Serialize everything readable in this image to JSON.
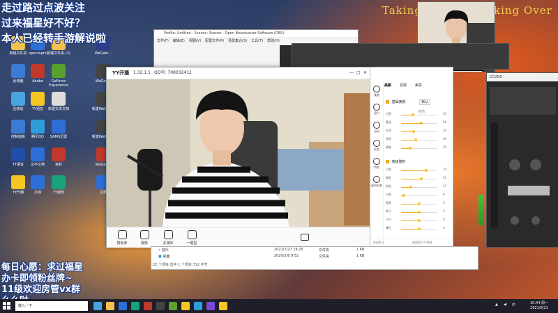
{
  "overlay_top": [
    "走过路过点波关注",
    "过来福星好不好？",
    "本人已经转手游解说啦"
  ],
  "overlay_bottom": [
    "每日心愿：求过福星",
    "办卡即领粉丝牌~",
    "11级欢迎房管vx群",
    "么么哒"
  ],
  "banner": {
    "left": "Taking",
    "right": "king Over"
  },
  "desktop_icons": [
    {
      "label": "新建文件夹",
      "color": "#f2c14e"
    },
    {
      "label": "openmpm",
      "color": "#2d6fd6"
    },
    {
      "label": "新建文件夹 (2)",
      "color": "#f2c14e"
    },
    {
      "label": "WeGam...",
      "color": "#2c3e8a"
    },
    {
      "label": "此电脑",
      "color": "#3a7bd5"
    },
    {
      "label": "Adobe",
      "color": "#c0392b"
    },
    {
      "label": "GeForce Experience",
      "color": "#5aa02c"
    },
    {
      "label": "WeGame",
      "color": "#444"
    },
    {
      "label": "回收站",
      "color": "#4aa3df"
    },
    {
      "label": "YY语音",
      "color": "#f5c623"
    },
    {
      "label": "新建文本文档",
      "color": "#ddd"
    },
    {
      "label": "新建WeGame",
      "color": "#444"
    },
    {
      "label": "控制面板",
      "color": "#3a7bd5"
    },
    {
      "label": "腾讯QQ",
      "color": "#2d9cdb"
    },
    {
      "label": "SAMS迅雷",
      "color": "#2d6fd6"
    },
    {
      "label": "新建WeGame",
      "color": "#444"
    },
    {
      "label": "TT语音",
      "color": "#1f4fa8"
    },
    {
      "label": "文字文档",
      "color": "#2d6fd6"
    },
    {
      "label": "资料",
      "color": "#c0392b"
    },
    {
      "label": "WeGame",
      "color": "#c0392b"
    },
    {
      "label": "YY开播",
      "color": "#f5c623"
    },
    {
      "label": "文档",
      "color": "#2d6fd6"
    },
    {
      "label": "YY游戏",
      "color": "#1aa37a"
    },
    {
      "label": "文档",
      "color": "#2d6fd6"
    }
  ],
  "obs": {
    "title": "Profile: Untitled - Scenes: Scenes - Open Broadcaster Software (OBS)",
    "menu": [
      "文件(F)",
      "编辑(E)",
      "视图(V)",
      "配置文件(P)",
      "场景集合(S)",
      "工具(T)",
      "帮助(H)"
    ]
  },
  "yy": {
    "logo": "YY开播",
    "version": "1.32.1.1",
    "qq": "QQ号: 708032412",
    "bottom_buttons": [
      {
        "label": "模板库"
      },
      {
        "label": "摄像"
      },
      {
        "label": "多媒体"
      },
      {
        "label": "一键抠"
      }
    ],
    "window_controls": [
      "—",
      "□",
      "✕"
    ]
  },
  "beauty": {
    "tabs": [
      "美颜",
      "滤镜",
      "美妆"
    ],
    "active_tab": "美颜",
    "side_items": [
      "美颜",
      "窗口",
      "自动",
      "抠图",
      "特效",
      "虚拟形象"
    ],
    "section1": {
      "label": "基础美颜",
      "dropdown": "默认",
      "extra": "自然"
    },
    "section1_sliders": [
      {
        "label": "白皙",
        "value": 33,
        "pct": 0.33
      },
      {
        "label": "磨皮",
        "value": 56,
        "pct": 0.56
      },
      {
        "label": "红润",
        "value": 34,
        "pct": 0.34
      },
      {
        "label": "锐化",
        "value": 40,
        "pct": 0.4
      },
      {
        "label": "清晰",
        "value": 25,
        "pct": 0.25
      }
    ],
    "section2": {
      "label": "高级整形"
    },
    "section2_sliders": [
      {
        "label": "小脸",
        "value": 70,
        "pct": 0.7
      },
      {
        "label": "瘦脸",
        "value": 55,
        "pct": 0.55
      },
      {
        "label": "削脸",
        "value": 27,
        "pct": 0.27
      },
      {
        "label": "大眼",
        "value": 8,
        "pct": 0.08
      },
      {
        "label": "眼距",
        "value": 0,
        "pct": 0.5
      },
      {
        "label": "鼻子",
        "value": 0,
        "pct": 0.5
      },
      {
        "label": "下巴",
        "value": 0,
        "pct": 0.5
      },
      {
        "label": "嘴巴",
        "value": 0,
        "pct": 0.5
      }
    ],
    "footer_left": "恢复默认",
    "footer_right": "美颜提示YY美颜"
  },
  "explorer": {
    "rows": [
      {
        "name": "音乐",
        "date": "2021/7/27 19:25",
        "type": "文件夹",
        "size": "1 KB"
      },
      {
        "name": "桌面",
        "date": "2020/2/6 9:52",
        "type": "文件夹",
        "size": "1 KB"
      }
    ],
    "status": "22 个项目   选中 1 个项目 712 字节"
  },
  "right_window": {
    "title": "CCVDO"
  },
  "taskbar": {
    "search_placeholder": "键入一下",
    "clock_time": "10:44 周一",
    "clock_date": "2021/6/21",
    "app_colors": [
      "#4aa3df",
      "#f2c14e",
      "#2d6fd6",
      "#1aa37a",
      "#c0392b",
      "#444",
      "#5aa02c",
      "#f5c623",
      "#2d9cdb",
      "#7a4ad5",
      "#f5c623"
    ]
  },
  "colors": {
    "accent": "#f5a623",
    "overlay_stroke": "#1a3a8a",
    "banner": "#f2d24a"
  }
}
